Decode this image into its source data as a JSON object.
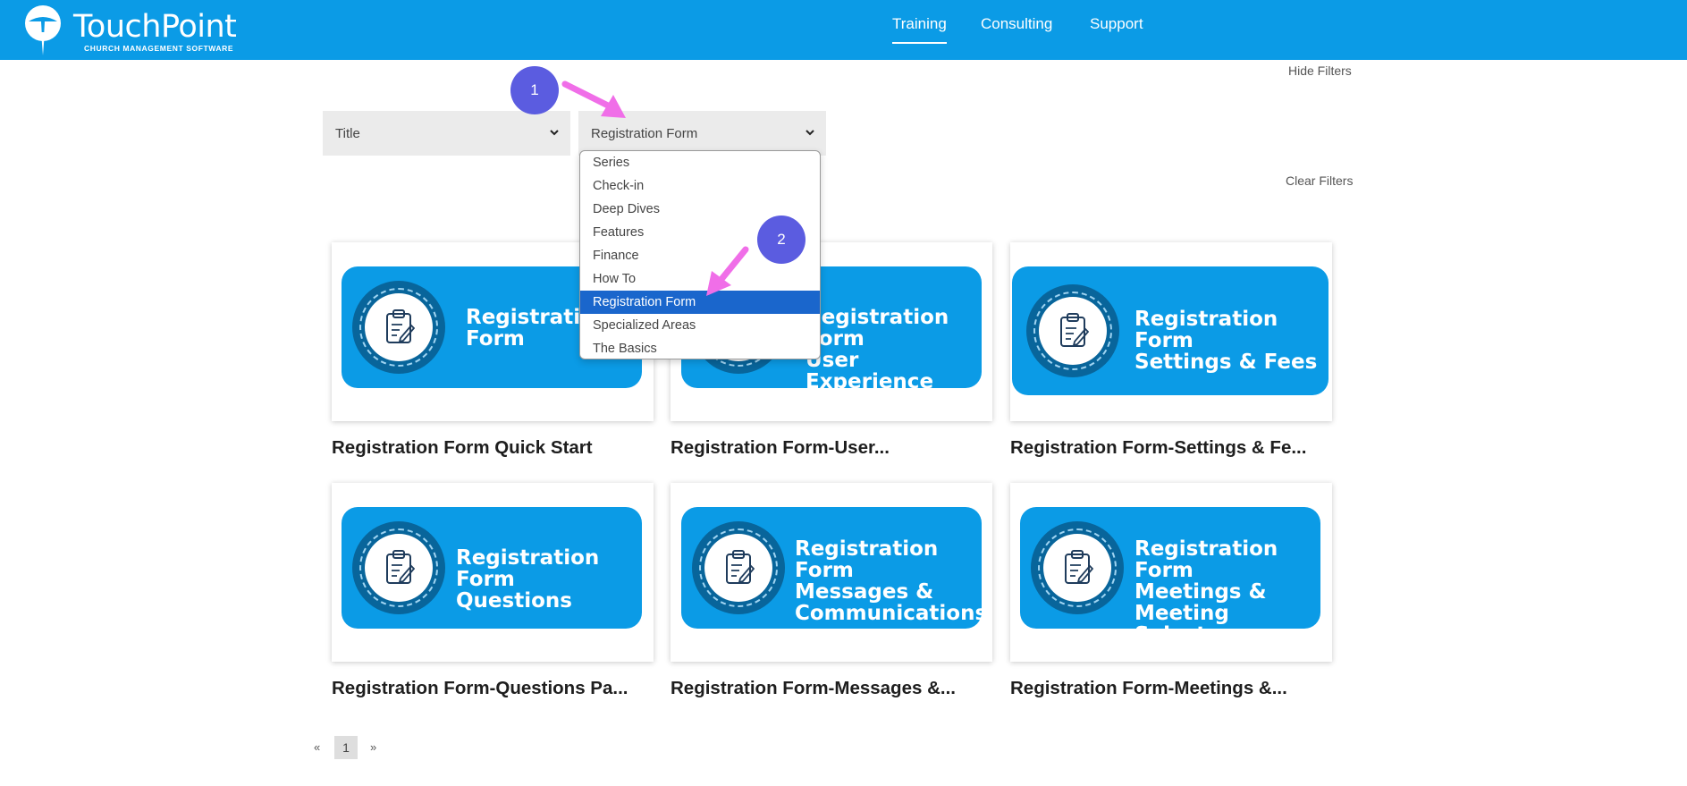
{
  "header": {
    "logo_title": "TouchPoint",
    "logo_subtitle": "CHURCH MANAGEMENT SOFTWARE",
    "nav": [
      {
        "label": "Training",
        "active": true
      },
      {
        "label": "Consulting",
        "active": false
      },
      {
        "label": "Support",
        "active": false
      }
    ]
  },
  "filters": {
    "hide_label": "Hide Filters",
    "clear_label": "Clear Filters",
    "sort_select": {
      "value": "Title"
    },
    "category_select": {
      "value": "Registration Form"
    },
    "dropdown_options": [
      "Series",
      "Check-in",
      "Deep Dives",
      "Features",
      "Finance",
      "How To",
      "Registration Form",
      "Specialized Areas",
      "The Basics"
    ],
    "dropdown_selected": "Registration Form"
  },
  "cards": [
    {
      "banner": "Registration\nForm",
      "title": "Registration Form Quick Start"
    },
    {
      "banner": "Registration Form\nUser Experience",
      "title": "Registration Form-User..."
    },
    {
      "banner": "Registration Form\nSettings & Fees",
      "title": "Registration Form-Settings & Fe..."
    },
    {
      "banner": "Registration Form\nQuestions",
      "title": "Registration Form-Questions Pa..."
    },
    {
      "banner": "Registration Form\nMessages &\nCommunications",
      "title": "Registration Form-Messages &..."
    },
    {
      "banner": "Registration Form\nMeetings &\nMeeting Selector",
      "title": "Registration Form-Meetings &..."
    }
  ],
  "pagination": {
    "prev": "«",
    "current": "1",
    "next": "»"
  },
  "annotations": {
    "step1": "1",
    "step2": "2"
  },
  "colors": {
    "brand": "#0b9be6",
    "selected": "#1a66cc",
    "step": "#5b5ce0",
    "arrow": "#f06ee8"
  }
}
